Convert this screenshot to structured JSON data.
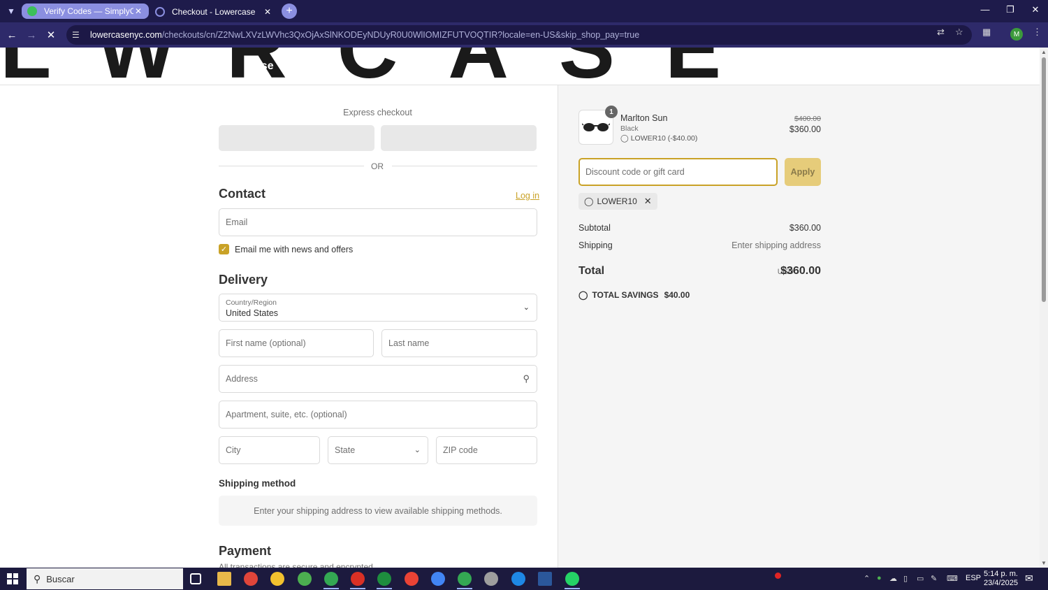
{
  "browser": {
    "tabs": [
      {
        "title": "Verify Codes — SimplyCodes",
        "active": false
      },
      {
        "title": "Checkout - Lowercase",
        "active": true
      }
    ],
    "url_host": "lowercasenyc.com",
    "url_path": "/checkouts/cn/Z2NwLXVzLWVhc3QxOjAxSlNKODEyNDUyR0U0WlIOMIZFUTVOQTIR?locale=en-US&skip_shop_pay=true",
    "profile_initial": "M"
  },
  "banner": {
    "art_text": "LWRCASE",
    "brand_fragment": "case"
  },
  "checkout": {
    "express_title": "Express checkout",
    "or_text": "OR",
    "contact_heading": "Contact",
    "login_link": "Log in",
    "email_placeholder": "Email",
    "newsletter_label": "Email me with news and offers",
    "newsletter_checked": true,
    "delivery_heading": "Delivery",
    "country_label": "Country/Region",
    "country_value": "United States",
    "first_name_placeholder": "First name (optional)",
    "last_name_placeholder": "Last name",
    "address_placeholder": "Address",
    "apartment_placeholder": "Apartment, suite, etc. (optional)",
    "city_placeholder": "City",
    "state_placeholder": "State",
    "zip_placeholder": "ZIP code",
    "shipping_method_heading": "Shipping method",
    "shipping_notice": "Enter your shipping address to view available shipping methods.",
    "payment_heading": "Payment",
    "payment_sub": "All transactions are secure and encrypted."
  },
  "summary": {
    "product": {
      "quantity": "1",
      "name": "Marlton Sun",
      "variant": "Black",
      "discount": "LOWER10 (-$40.00)",
      "price_original": "$400.00",
      "price_final": "$360.00"
    },
    "discount_placeholder": "Discount code or gift card",
    "apply_label": "Apply",
    "applied_code": "LOWER10",
    "subtotal_label": "Subtotal",
    "subtotal_value": "$360.00",
    "shipping_label": "Shipping",
    "shipping_value": "Enter shipping address",
    "total_label": "Total",
    "total_currency": "USD",
    "total_value": "$360.00",
    "savings_label": "TOTAL SAVINGS",
    "savings_value": "$40.00"
  },
  "taskbar": {
    "search_text": "Buscar",
    "language": "ESP",
    "time": "5:14 p. m.",
    "date": "23/4/2025"
  },
  "colors": {
    "accent": "#c9a227",
    "apply_bg": "#e6cc7a",
    "chrome_bg": "#1e1b4b",
    "taskbar_bg": "#1c1a3e"
  }
}
